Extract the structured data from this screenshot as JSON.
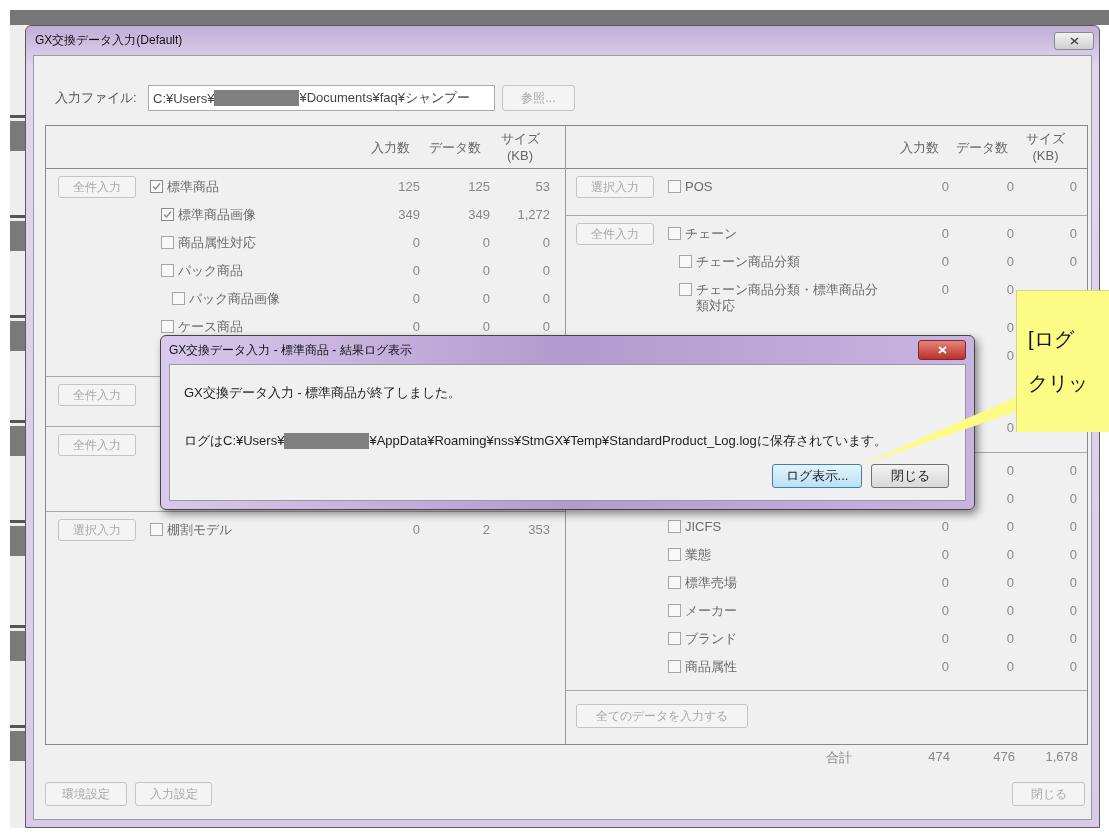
{
  "window": {
    "title": "GX交換データ入力(Default)"
  },
  "file_input": {
    "label": "入力ファイル:",
    "path_start": "C:¥Users¥",
    "redacted": true,
    "path_end": "¥Documents¥faq¥シャンプー",
    "browse_button": {
      "label": "参照...",
      "disabled": true
    }
  },
  "left_panel": {
    "columns": [
      "入力数",
      "データ数",
      "サイズ\n(KB)"
    ],
    "groups": [
      {
        "button": {
          "label": "全件入力",
          "disabled": true
        },
        "items": [
          {
            "label": "標準商品",
            "checked": true,
            "input": "125",
            "data": "125",
            "size": "53",
            "children": [
              {
                "label": "標準商品画像",
                "checked": true,
                "input": "349",
                "data": "349",
                "size": "1,272"
              },
              {
                "label": "商品属性対応",
                "checked": false,
                "input": "0",
                "data": "0",
                "size": "0"
              },
              {
                "label": "パック商品",
                "checked": false,
                "input": "0",
                "data": "0",
                "size": "0",
                "children": [
                  {
                    "label": "パック商品画像",
                    "checked": false,
                    "input": "0",
                    "data": "0",
                    "size": "0"
                  }
                ]
              },
              {
                "label": "ケース商品",
                "checked": false,
                "input": "0",
                "data": "0",
                "size": "0"
              }
            ]
          }
        ]
      },
      {
        "button": {
          "label": "全件入力",
          "disabled": true
        }
      },
      {
        "button": {
          "label": "全件入力",
          "disabled": true
        }
      },
      {
        "button": {
          "label": "選択入力",
          "disabled": true
        },
        "items": [
          {
            "label": "棚割モデル",
            "checked": false,
            "input": "0",
            "data": "2",
            "size": "353"
          }
        ]
      }
    ]
  },
  "right_panel": {
    "columns": [
      "入力数",
      "データ数",
      "サイズ\n(KB)"
    ],
    "groups": [
      {
        "button": {
          "label": "選択入力",
          "disabled": true
        },
        "items": [
          {
            "label": "POS",
            "checked": false,
            "input": "0",
            "data": "0",
            "size": "0"
          }
        ]
      },
      {
        "button": {
          "label": "全件入力",
          "disabled": true
        },
        "items": [
          {
            "label": "チェーン",
            "checked": false,
            "input": "0",
            "data": "0",
            "size": "0",
            "children": [
              {
                "label": "チェーン商品分類",
                "checked": false,
                "input": "0",
                "data": "0",
                "size": "0"
              },
              {
                "label": "チェーン商品分類・標準商品分類対応",
                "checked": false,
                "input": "0",
                "data": "0"
              },
              {
                "data": "0"
              },
              {
                "data": "0"
              },
              {
                "data": "0"
              }
            ]
          }
        ]
      },
      {
        "items": [
          {
            "data": "0",
            "size": "0"
          },
          {
            "data": "0",
            "size": "0"
          },
          {
            "label": "JICFS",
            "checked": false,
            "input": "0",
            "data": "0",
            "size": "0"
          },
          {
            "label": "業態",
            "checked": false,
            "input": "0",
            "data": "0",
            "size": "0"
          },
          {
            "label": "標準売場",
            "checked": false,
            "input": "0",
            "data": "0",
            "size": "0"
          },
          {
            "label": "メーカー",
            "checked": false,
            "input": "0",
            "data": "0",
            "size": "0"
          },
          {
            "label": "ブランド",
            "checked": false,
            "input": "0",
            "data": "0",
            "size": "0"
          },
          {
            "label": "商品属性",
            "checked": false,
            "input": "0",
            "data": "0",
            "size": "0"
          }
        ]
      }
    ],
    "footer_button": {
      "label": "全てのデータを入力する",
      "disabled": true
    }
  },
  "totals": {
    "label": "合計",
    "input": "474",
    "data": "476",
    "size": "1,678"
  },
  "footer_buttons": [
    {
      "label": "環境設定",
      "disabled": true
    },
    {
      "label": "入力設定",
      "disabled": true
    }
  ],
  "close_button": {
    "label": "閉じる",
    "disabled": true
  },
  "dialog": {
    "title": "GX交換データ入力 - 標準商品 - 結果ログ表示",
    "message": "GX交換データ入力 - 標準商品が終了しました。",
    "log_start": "ログはC:¥Users¥",
    "redacted": true,
    "log_end": "¥AppData¥Roaming¥nss¥StmGX¥Temp¥StandardProduct_Log.logに保存されています。",
    "buttons": [
      {
        "label": "ログ表示...",
        "focused": true
      },
      {
        "label": "閉じる",
        "focused": false
      }
    ]
  },
  "callout": {
    "lines": [
      "[ログ",
      "クリッ"
    ]
  }
}
